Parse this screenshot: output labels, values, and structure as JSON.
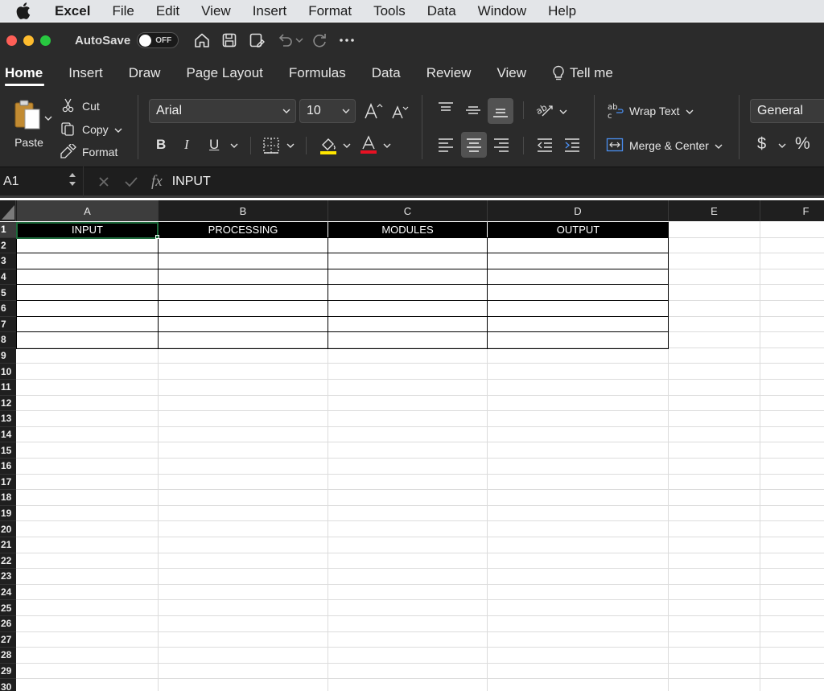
{
  "menubar": {
    "app": "Excel",
    "items": [
      "File",
      "Edit",
      "View",
      "Insert",
      "Format",
      "Tools",
      "Data",
      "Window",
      "Help"
    ]
  },
  "titlebar": {
    "autosave_label": "AutoSave",
    "autosave_state": "OFF"
  },
  "ribbon_tabs": [
    "Home",
    "Insert",
    "Draw",
    "Page Layout",
    "Formulas",
    "Data",
    "Review",
    "View"
  ],
  "tell_me": "Tell me",
  "clipboard": {
    "paste": "Paste",
    "cut": "Cut",
    "copy": "Copy",
    "format": "Format"
  },
  "font": {
    "name": "Arial",
    "size": "10"
  },
  "alignment": {
    "wrap_text": "Wrap Text",
    "merge_center": "Merge & Center"
  },
  "number": {
    "format": "General",
    "currency": "$",
    "percent": "%"
  },
  "formula_bar": {
    "name_box": "A1",
    "fx": "fx",
    "value": "INPUT"
  },
  "sheet": {
    "columns": [
      "A",
      "B",
      "C",
      "D",
      "E",
      "F"
    ],
    "rows": [
      "1",
      "2",
      "3",
      "4",
      "5",
      "6",
      "7",
      "8",
      "9",
      "10",
      "11",
      "12",
      "13",
      "14",
      "15",
      "16",
      "17",
      "18",
      "19",
      "20",
      "21",
      "22",
      "23",
      "24",
      "25",
      "26",
      "27",
      "28",
      "29",
      "30"
    ],
    "headers": [
      "INPUT",
      "PROCESSING",
      "MODULES",
      "OUTPUT"
    ]
  },
  "colors": {
    "accent": "#1e6b3c",
    "font_color": "#e81123",
    "highlight": "#ffe600"
  }
}
